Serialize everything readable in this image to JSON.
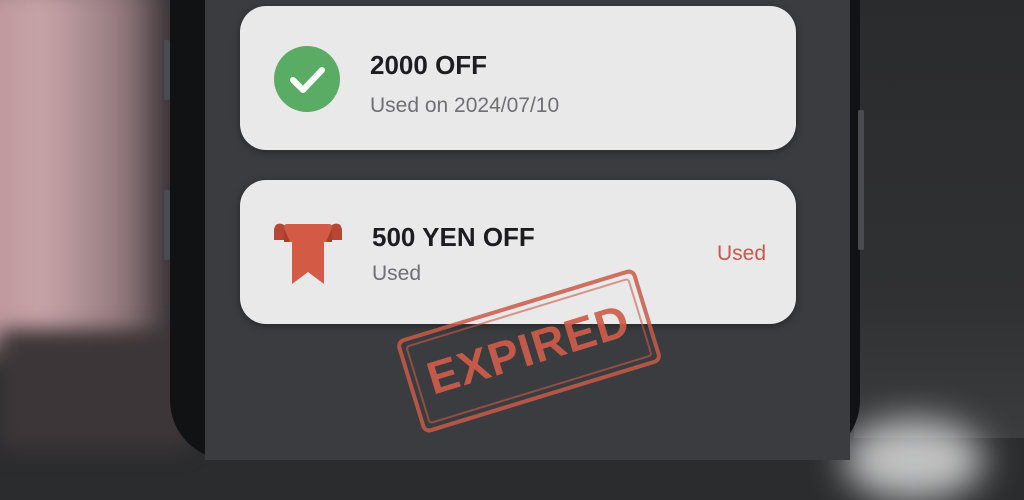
{
  "coupons": [
    {
      "title": "2000 OFF",
      "subtitle": "Used on 2024/07/10",
      "icon": "checkmark-circle-icon",
      "icon_color": "#5aab63"
    },
    {
      "title": "500 YEN OFF",
      "subtitle": "Used",
      "status": "Used",
      "icon": "ribbon-icon",
      "icon_color": "#d35a45",
      "status_color": "#c9584a"
    }
  ],
  "stamp": {
    "text": "EXPIRED",
    "color": "#cf5c49"
  }
}
